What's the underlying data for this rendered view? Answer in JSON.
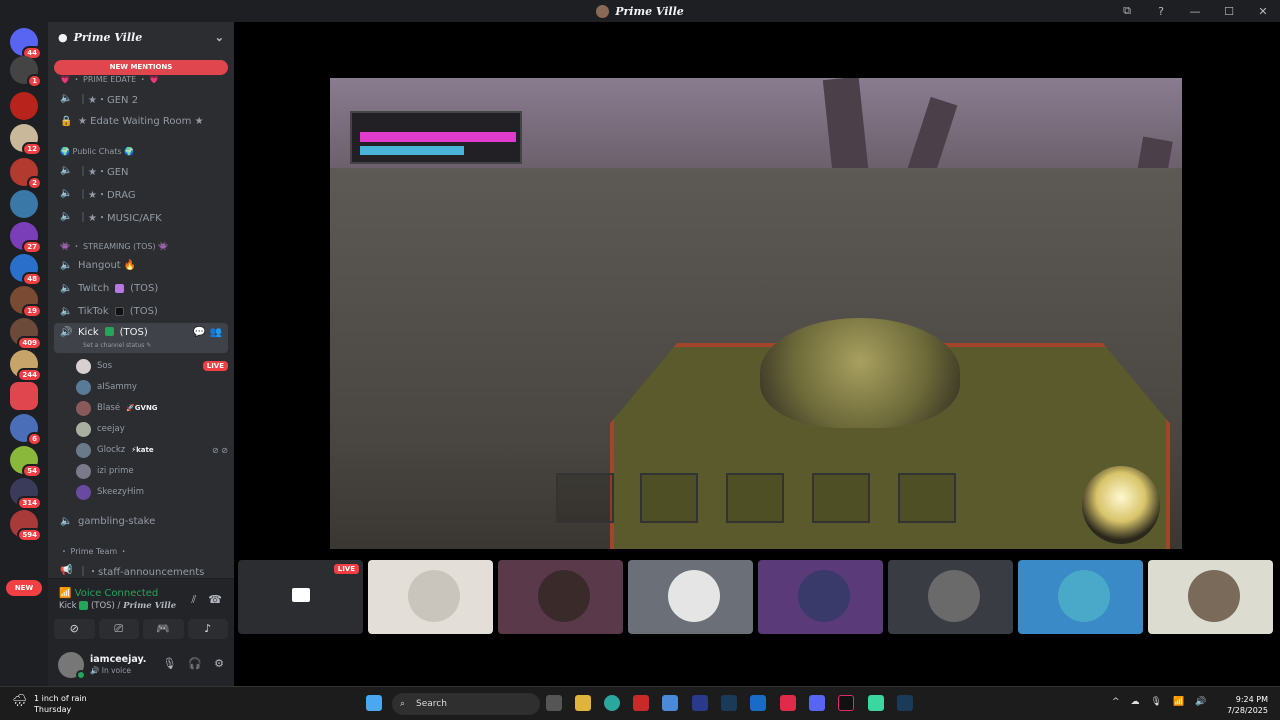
{
  "window": {
    "title": "Prime Ville",
    "buttons": [
      "⧉",
      "?",
      "—",
      "☐",
      "✕"
    ]
  },
  "rail": {
    "servers": [
      {
        "name": "discord-home",
        "badge": "44",
        "color": "#5865f2"
      },
      {
        "name": "server-2",
        "badge": "1",
        "color": "#444"
      },
      {
        "name": "server-3",
        "badge": "",
        "color": "#b8231b"
      },
      {
        "name": "server-4",
        "badge": "12",
        "color": "#c9b89a"
      },
      {
        "name": "server-5",
        "badge": "2",
        "color": "#b33a2e"
      },
      {
        "name": "server-6",
        "badge": "",
        "color": "#3a78a8"
      },
      {
        "name": "server-7",
        "badge": "27",
        "color": "#7a3fb8"
      },
      {
        "name": "server-8",
        "badge": "48",
        "color": "#2a6fc9"
      },
      {
        "name": "server-9",
        "badge": "19",
        "color": "#7a4a32"
      },
      {
        "name": "server-10",
        "badge": "409",
        "color": "#6b4a3a"
      },
      {
        "name": "server-11",
        "badge": "244",
        "color": "#c7a46a"
      },
      {
        "name": "server-12",
        "badge": "",
        "color": "#e0464e"
      },
      {
        "name": "server-13",
        "badge": "6",
        "color": "#4a6fb8"
      },
      {
        "name": "server-14",
        "badge": "54",
        "color": "#8ab83a"
      },
      {
        "name": "server-15",
        "badge": "314",
        "color": "#3a3a5a"
      },
      {
        "name": "server-16",
        "badge": "594",
        "color": "#a83a3a"
      }
    ],
    "new_label": "NEW"
  },
  "sidebar": {
    "server_name": "Prime Ville",
    "new_mentions": "NEW MENTIONS",
    "cat_prime_edate": "💗 ・ PRIME EDATE ・ 💗",
    "gen2": "｜★・GEN 2",
    "edate_waiting": "★ Edate Waiting Room ★",
    "cat_public": "🌍 Public Chats 🌍",
    "gen": "｜★・GEN",
    "drag": "｜★・DRAG",
    "music": "｜★・MUSIC/AFK",
    "cat_streaming": "👾 ・ STREAMING (TOS) 👾",
    "hangout": "Hangout 🔥",
    "twitch": "Twitch",
    "twitch_suffix": "(TOS)",
    "tiktok": "TikTok",
    "tiktok_suffix": "(TOS)",
    "kick": "Kick",
    "kick_suffix": "(TOS)",
    "kick_status": "Set a channel status ✎",
    "users": [
      {
        "name": "Sos",
        "tag": "",
        "live": "LIVE",
        "color": "#d8d0d0"
      },
      {
        "name": "aISammy",
        "tag": "",
        "live": "",
        "color": "#5a7a9a"
      },
      {
        "name": "Blasé",
        "tag": "🚀GVNG",
        "live": "",
        "color": "#8a5a5a"
      },
      {
        "name": "ceejay",
        "tag": "",
        "live": "",
        "color": "#aab0a0"
      },
      {
        "name": "Glockz",
        "tag": "⚡kate",
        "live": "",
        "color": "#6a7a8a"
      },
      {
        "name": "izi prime",
        "tag": "",
        "live": "",
        "color": "#7a7a8a"
      },
      {
        "name": "SkeezyHim",
        "tag": "",
        "live": "",
        "color": "#6a4aa0"
      }
    ],
    "gambling": "gambling-stake",
    "cat_team": "・ Prime Team ・",
    "staff": "｜・staff-announcements"
  },
  "voice": {
    "status": "Voice Connected",
    "channel": "Kick",
    "channel_suffix": "(TOS) /",
    "server": "Prime Ville"
  },
  "user": {
    "name": "iamceejay.",
    "status": "In voice"
  },
  "stream": {
    "live": "LIVE"
  },
  "tiles": [
    {
      "bg": "#2b2d31",
      "av": "#555"
    },
    {
      "bg": "#e3ded8",
      "av": "#c9c4bc"
    },
    {
      "bg": "#5a3a4a",
      "av": "#3a2a2a"
    },
    {
      "bg": "#6a6f78",
      "av": "#e5e5e5"
    },
    {
      "bg": "#5a3a78",
      "av": "#3a3a6a"
    },
    {
      "bg": "#3a3c44",
      "av": "#6a6a6a"
    },
    {
      "bg": "#3a8ac8",
      "av": "#4aa8c8"
    },
    {
      "bg": "#dcdcd0",
      "av": "#7a6a5a"
    }
  ],
  "taskbar": {
    "weather_line1": "1 inch of rain",
    "weather_line2": "Thursday",
    "search": "Search",
    "time": "9:24 PM",
    "date": "7/28/2025"
  }
}
